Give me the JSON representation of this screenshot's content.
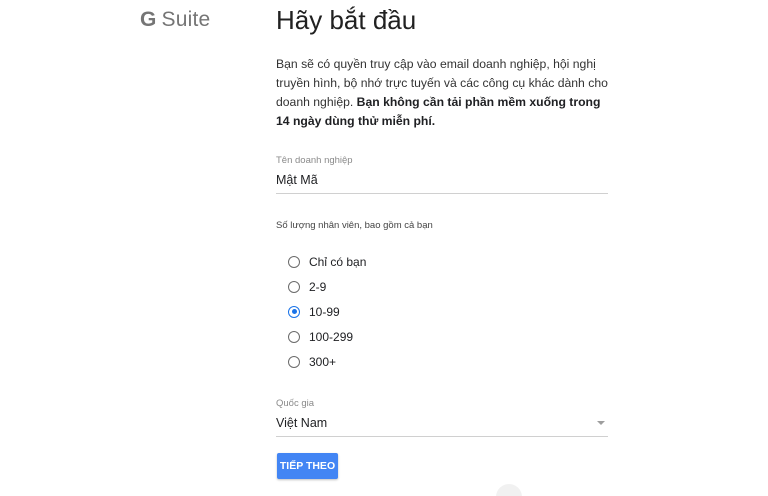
{
  "logo": {
    "g": "G",
    "suite": "Suite"
  },
  "title": "Hãy bắt đầu",
  "intro": {
    "text": "Bạn sẽ có quyền truy cập vào email doanh nghiệp, hội nghị truyền hình, bộ nhớ trực tuyến và các công cụ khác dành cho doanh nghiệp. ",
    "bold": "Bạn không cần tải phần mềm xuống trong 14 ngày dùng thử miễn phí."
  },
  "business_name": {
    "label": "Tên doanh nghiệp",
    "value": "Mật Mã"
  },
  "employees": {
    "question": "Số lượng nhân viên, bao gồm cả bạn",
    "options": [
      "Chỉ có bạn",
      "2-9",
      "10-99",
      "100-299",
      "300+"
    ],
    "selected": "10-99"
  },
  "country": {
    "label": "Quốc gia",
    "value": "Việt Nam"
  },
  "next_button": {
    "label": "TIẾP THEO"
  },
  "colors": {
    "accent": "#1a73e8",
    "button": "#4285f4"
  }
}
